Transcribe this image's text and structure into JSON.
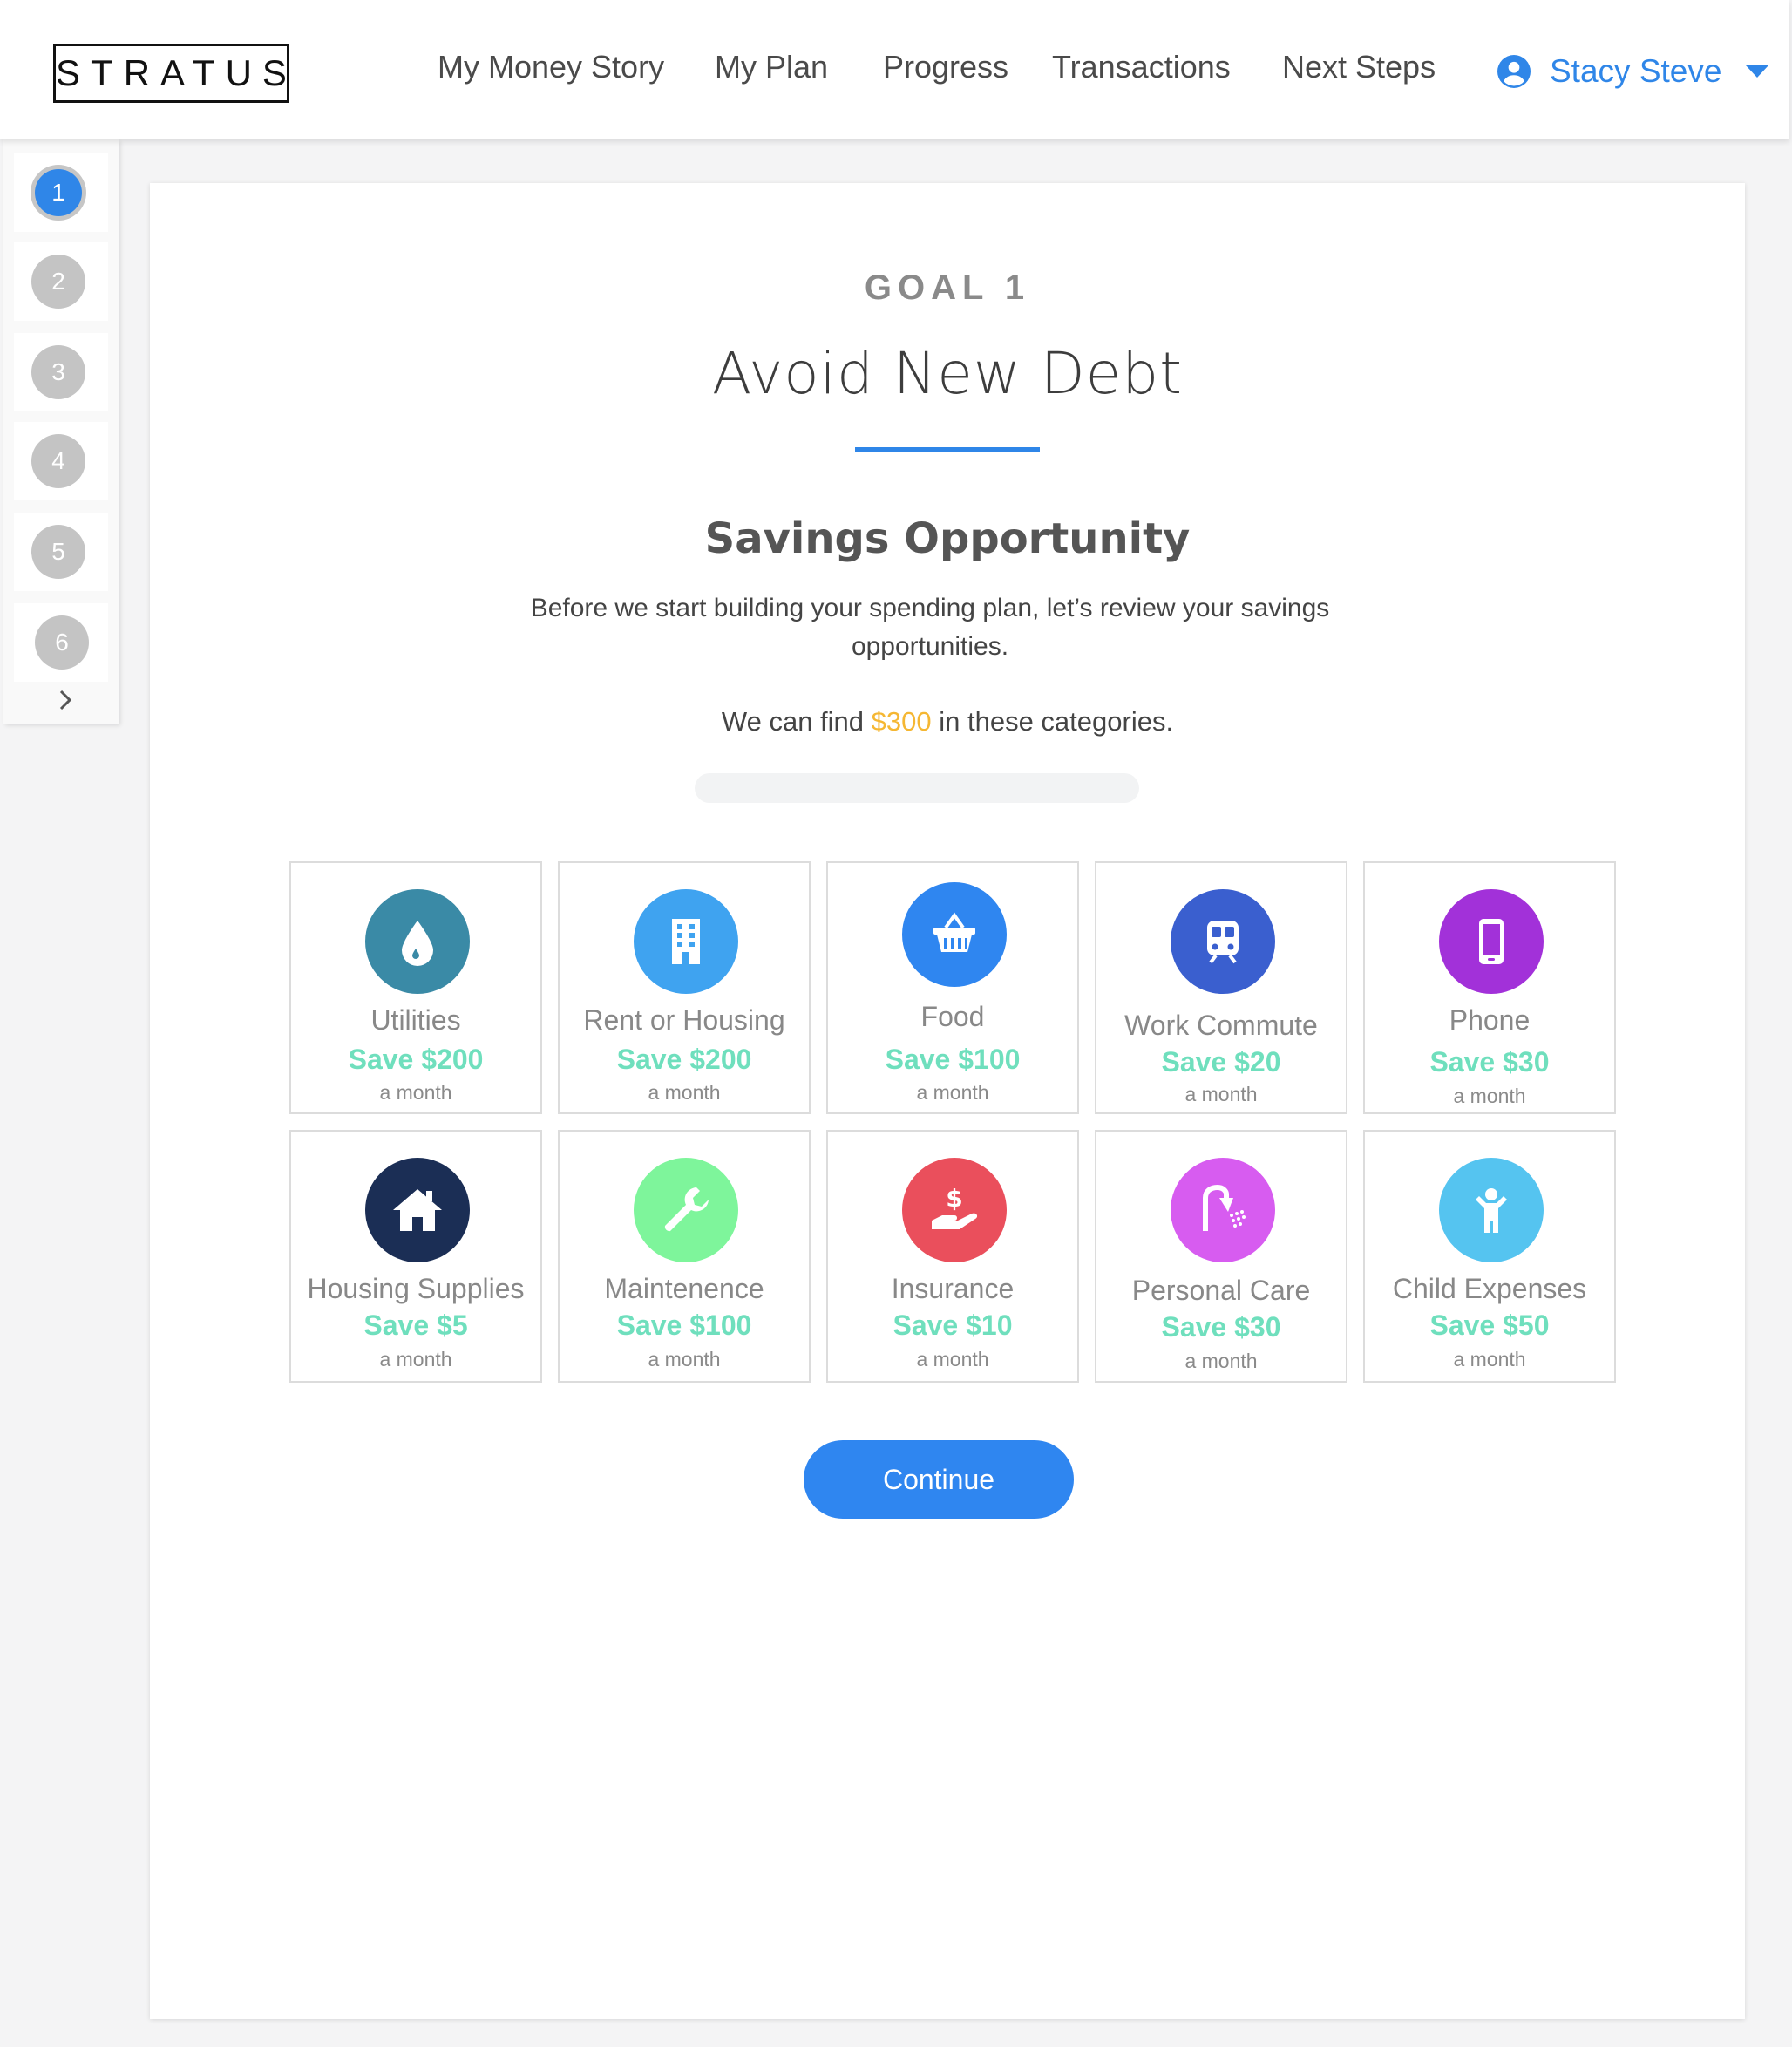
{
  "app": {
    "logo_text": "STRATUS"
  },
  "nav": {
    "items": [
      {
        "label": "My Money Story"
      },
      {
        "label": "My Plan"
      },
      {
        "label": "Progress"
      },
      {
        "label": "Transactions"
      },
      {
        "label": "Next Steps"
      }
    ]
  },
  "user": {
    "name": "Stacy Steve",
    "icon": "user-circle-icon",
    "color": "#2f86e8"
  },
  "stepper": {
    "steps": [
      "1",
      "2",
      "3",
      "4",
      "5",
      "6"
    ],
    "active_step": "1",
    "next_icon": "chevron-right-icon"
  },
  "goal": {
    "eyebrow": "GOAL 1",
    "title": "Avoid New Debt"
  },
  "savings": {
    "heading": "Savings Opportunity",
    "intro": "Before we start building your spending plan, let’s review your savings opportunities.",
    "find_prefix": "We can find ",
    "find_amount": "$300",
    "find_suffix": " in these categories."
  },
  "categories": [
    {
      "name": "Utilities",
      "save": "Save $200",
      "period": "a month",
      "icon": "water-drop-icon",
      "color": "#3a8aa6"
    },
    {
      "name": "Rent or Housing",
      "save": "Save $200",
      "period": "a month",
      "icon": "building-icon",
      "color": "#3fa3f0"
    },
    {
      "name": "Food",
      "save": "Save $100",
      "period": "a month",
      "icon": "basket-icon",
      "color": "#2f86f0"
    },
    {
      "name": "Work Commute",
      "save": "Save $20",
      "period": "a month",
      "icon": "train-icon",
      "color": "#3a5fcf"
    },
    {
      "name": "Phone",
      "save": "Save $30",
      "period": "a month",
      "icon": "phone-icon",
      "color": "#a231d9"
    },
    {
      "name": "Housing Supplies",
      "save": "Save $5",
      "period": "a month",
      "icon": "house-icon",
      "color": "#1b2e55"
    },
    {
      "name": "Maintenence",
      "save": "Save $100",
      "period": "a month",
      "icon": "wrench-icon",
      "color": "#7ef59b"
    },
    {
      "name": "Insurance",
      "save": "Save $10",
      "period": "a month",
      "icon": "hand-dollar-icon",
      "color": "#ea4f5c"
    },
    {
      "name": "Personal Care",
      "save": "Save $30",
      "period": "a month",
      "icon": "shower-icon",
      "color": "#d75cf0"
    },
    {
      "name": "Child Expenses",
      "save": "Save $50",
      "period": "a month",
      "icon": "child-icon",
      "color": "#55c4f0"
    }
  ],
  "colors": {
    "accent": "#2f86e8",
    "highlight": "#f5b733",
    "savings_text": "#6fdfbd"
  },
  "actions": {
    "continue_label": "Continue"
  }
}
